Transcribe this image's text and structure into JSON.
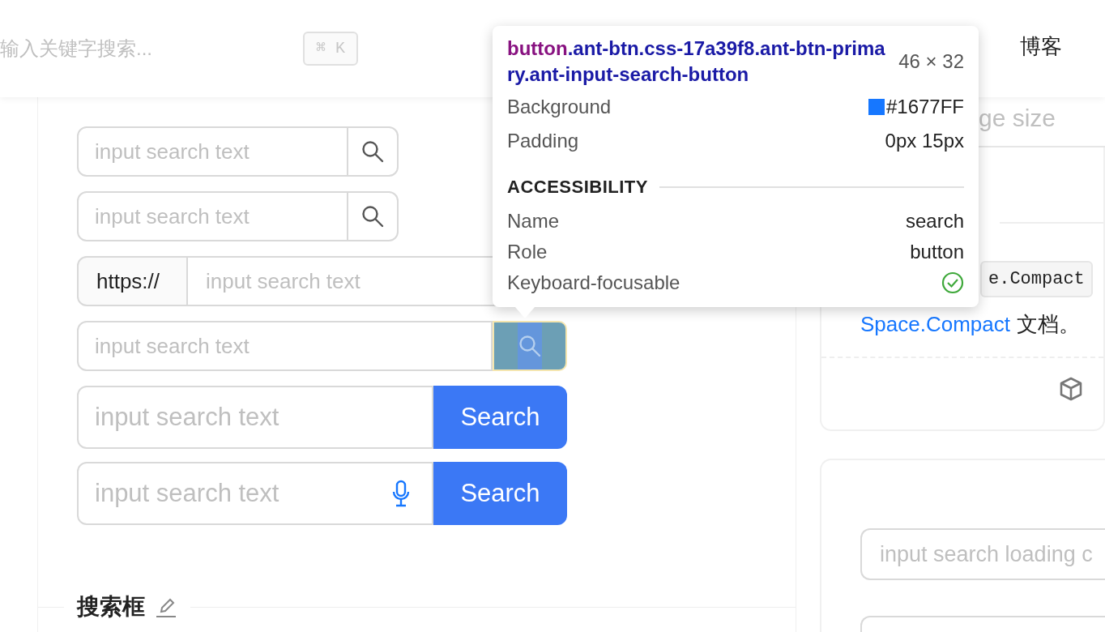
{
  "header": {
    "search_placeholder": "输入关键字搜索...",
    "shortcut": "⌘ K",
    "nav_item": "博客"
  },
  "demo_inputs": [
    {
      "kind": "icon-button",
      "placeholder": "input search text"
    },
    {
      "kind": "icon-button",
      "placeholder": "input search text"
    },
    {
      "kind": "addon",
      "addon": "https://",
      "placeholder": "input search text"
    },
    {
      "kind": "primary-icon",
      "placeholder": "input search text",
      "inspected": true
    },
    {
      "kind": "enter-button",
      "placeholder": "input search text",
      "button_label": "Search"
    },
    {
      "kind": "enter-button-mic",
      "placeholder": "input search text",
      "button_label": "Search"
    }
  ],
  "section_title": "搜索框",
  "tooltip": {
    "tag": "button",
    "classes": ".ant-btn.css-17a39f8.ant-btn-primary.ant-input-search-button",
    "size": "46 × 32",
    "properties": [
      {
        "label": "Background",
        "value": "#1677FF",
        "color": "#1677ff"
      },
      {
        "label": "Padding",
        "value": "0px 15px"
      }
    ],
    "section": "ACCESSIBILITY",
    "accessibility": [
      {
        "label": "Name",
        "value": "search"
      },
      {
        "label": "Role",
        "value": "button"
      },
      {
        "label": "Keyboard-focusable",
        "checked": true
      }
    ]
  },
  "right": {
    "size_placeholder": "ge size",
    "code": "e.Compact",
    "link": "Space.Compact",
    "text": "文档。",
    "loading_placeholder": "input search loading c"
  }
}
